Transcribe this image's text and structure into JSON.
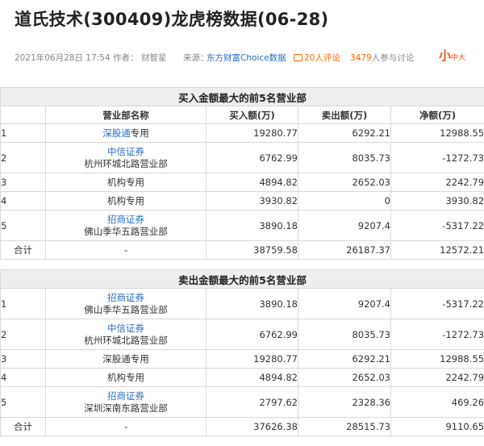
{
  "article": {
    "title": "道氏技术(300409)龙虎榜数据(06-28)",
    "date": "2021年06月28日 17:54",
    "author_label": "作者：",
    "author": "财智星",
    "source_label": "来源：",
    "source": "东方财富Choice数据",
    "comments": "20人评论",
    "participants_count": "3479",
    "participants_label": "人参与讨论",
    "logo_main": "小",
    "logo_sub": "中大"
  },
  "headers": {
    "rank": "",
    "dept": "营业部名称",
    "buy": "买入额(万)",
    "sell": "卖出额(万)",
    "net": "净额(万)"
  },
  "buy_table": {
    "caption": "买入金额最大的前5名营业部",
    "rows": [
      {
        "rank": "1",
        "firm": "",
        "name_link": "深股通",
        "name_rest": "专用",
        "buy": "19280.77",
        "sell": "6292.21",
        "net": "12988.55"
      },
      {
        "rank": "2",
        "firm": "中信证券",
        "branch": "杭州环城北路营业部",
        "buy": "6762.99",
        "sell": "8035.73",
        "net": "-1272.73"
      },
      {
        "rank": "3",
        "firm": "",
        "branch": "机构专用",
        "buy": "4894.82",
        "sell": "2652.03",
        "net": "2242.79"
      },
      {
        "rank": "4",
        "firm": "",
        "branch": "机构专用",
        "buy": "3930.82",
        "sell": "0",
        "net": "3930.82"
      },
      {
        "rank": "5",
        "firm": "招商证券",
        "branch": "佛山季华五路营业部",
        "buy": "3890.18",
        "sell": "9207.4",
        "net": "-5317.22"
      }
    ],
    "total": {
      "label": "合计",
      "dept": "-",
      "buy": "38759.58",
      "sell": "26187.37",
      "net": "12572.21"
    }
  },
  "sell_table": {
    "caption": "卖出金额最大的前5名营业部",
    "rows": [
      {
        "rank": "1",
        "firm": "招商证券",
        "branch": "佛山季华五路营业部",
        "buy": "3890.18",
        "sell": "9207.4",
        "net": "-5317.22"
      },
      {
        "rank": "2",
        "firm": "中信证券",
        "branch": "杭州环城北路营业部",
        "buy": "6762.99",
        "sell": "8035.73",
        "net": "-1272.73"
      },
      {
        "rank": "3",
        "firm": "",
        "branch": "深股通专用",
        "buy": "19280.77",
        "sell": "6292.21",
        "net": "12988.55"
      },
      {
        "rank": "4",
        "firm": "",
        "branch": "机构专用",
        "buy": "4894.82",
        "sell": "2652.03",
        "net": "2242.79"
      },
      {
        "rank": "5",
        "firm": "招商证券",
        "branch": "深圳深南东路营业部",
        "buy": "2797.62",
        "sell": "2328.36",
        "net": "469.26"
      }
    ],
    "total": {
      "label": "合计",
      "dept": "-",
      "buy": "37626.38",
      "sell": "28515.73",
      "net": "9110.65"
    }
  }
}
